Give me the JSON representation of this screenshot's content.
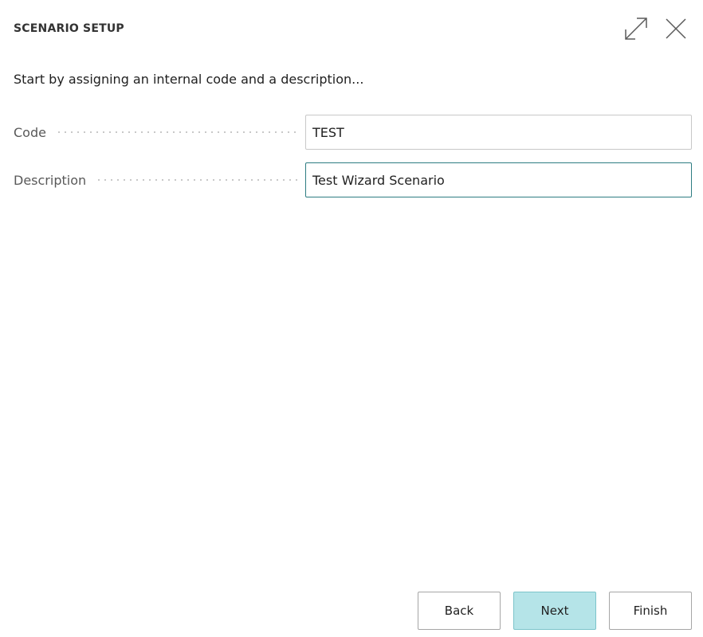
{
  "dialog": {
    "title": "SCENARIO SETUP",
    "intro": "Start by assigning an internal code and a description...",
    "icons": {
      "expand": "expand-arrows-icon",
      "close": "close-icon"
    }
  },
  "fields": {
    "code": {
      "label": "Code",
      "value": "TEST"
    },
    "description": {
      "label": "Description",
      "value": "Test Wizard Scenario"
    }
  },
  "footer": {
    "back_label": "Back",
    "next_label": "Next",
    "finish_label": "Finish"
  },
  "colors": {
    "accent_border": "#2d7c82",
    "primary_button_bg": "#b5e4e8"
  }
}
